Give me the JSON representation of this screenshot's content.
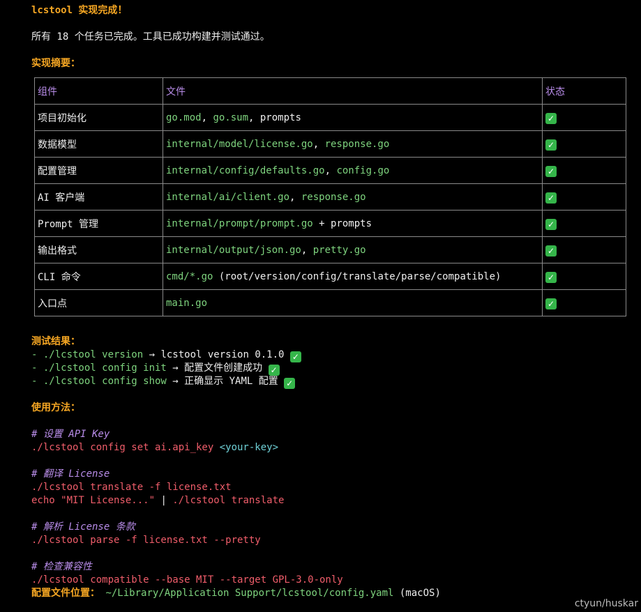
{
  "title": "lcstool 实现完成！",
  "summary": "所有 18 个任务已完成。工具已成功构建并测试通过。",
  "impl_heading": "实现摘要：",
  "table": {
    "headers": [
      "组件",
      "文件",
      "状态"
    ],
    "rows": [
      {
        "component": "项目初始化",
        "parts": [
          {
            "t": "go.mod",
            "c": "green"
          },
          {
            "t": ", ",
            "c": "white"
          },
          {
            "t": "go.sum",
            "c": "green"
          },
          {
            "t": ", prompts",
            "c": "white"
          }
        ],
        "status": "✓"
      },
      {
        "component": "数据模型",
        "parts": [
          {
            "t": "internal/model/license.go",
            "c": "green"
          },
          {
            "t": ", ",
            "c": "white"
          },
          {
            "t": "response.go",
            "c": "green"
          }
        ],
        "status": "✓"
      },
      {
        "component": "配置管理",
        "parts": [
          {
            "t": "internal/config/defaults.go",
            "c": "green"
          },
          {
            "t": ", ",
            "c": "white"
          },
          {
            "t": "config.go",
            "c": "green"
          }
        ],
        "status": "✓"
      },
      {
        "component": "AI 客户端",
        "parts": [
          {
            "t": "internal/ai/client.go",
            "c": "green"
          },
          {
            "t": ", ",
            "c": "white"
          },
          {
            "t": "response.go",
            "c": "green"
          }
        ],
        "status": "✓"
      },
      {
        "component": "Prompt 管理",
        "parts": [
          {
            "t": "internal/prompt/prompt.go",
            "c": "green"
          },
          {
            "t": " + prompts",
            "c": "white"
          }
        ],
        "status": "✓"
      },
      {
        "component": "输出格式",
        "parts": [
          {
            "t": "internal/output/json.go",
            "c": "green"
          },
          {
            "t": ", ",
            "c": "white"
          },
          {
            "t": "pretty.go",
            "c": "green"
          }
        ],
        "status": "✓"
      },
      {
        "component": "CLI 命令",
        "parts": [
          {
            "t": "cmd/*.go",
            "c": "green"
          },
          {
            "t": " (root/version/config/translate/parse/compatible)",
            "c": "white"
          }
        ],
        "status": "✓"
      },
      {
        "component": "入口点",
        "parts": [
          {
            "t": "main.go",
            "c": "green"
          }
        ],
        "status": "✓"
      }
    ]
  },
  "test_heading": "测试结果：",
  "tests": [
    {
      "dash": "- ",
      "cmd": "./lcstool version",
      "arrow": " → ",
      "result": "lcstool version 0.1.0",
      "check": "✓"
    },
    {
      "dash": "- ",
      "cmd": "./lcstool config init",
      "arrow": " → ",
      "result": "配置文件创建成功",
      "check": "✓"
    },
    {
      "dash": "- ",
      "cmd": "./lcstool config show",
      "arrow": " → ",
      "result": "正确显示 YAML 配置",
      "check": "✓"
    }
  ],
  "usage_heading": "使用方法：",
  "usage": {
    "c1": "# 设置 API Key",
    "l1a": "./lcstool config set ai.api_key ",
    "l1b": "<your-key>",
    "c2": "# 翻译 License",
    "l2": "./lcstool translate -f license.txt",
    "l3a": "echo \"MIT License...\" ",
    "l3b": "| ",
    "l3c": "./lcstool translate",
    "c3": "# 解析 License 条款",
    "l4": "./lcstool parse -f license.txt --pretty",
    "c4": "# 检查兼容性",
    "l5": "./lcstool compatible --base MIT --target GPL-3.0-only"
  },
  "config_loc_label": "配置文件位置：",
  "config_loc_path": "~/Library/Application Support/lcstool/config.yaml",
  "config_loc_note": " (macOS)",
  "watermark": "ctyun/huskar",
  "colors": {
    "background": "#000000",
    "orange": "#f5a623",
    "green": "#7ed37e",
    "red": "#ef5d6a",
    "purple": "#b88ce8",
    "check": "#35b54a"
  }
}
